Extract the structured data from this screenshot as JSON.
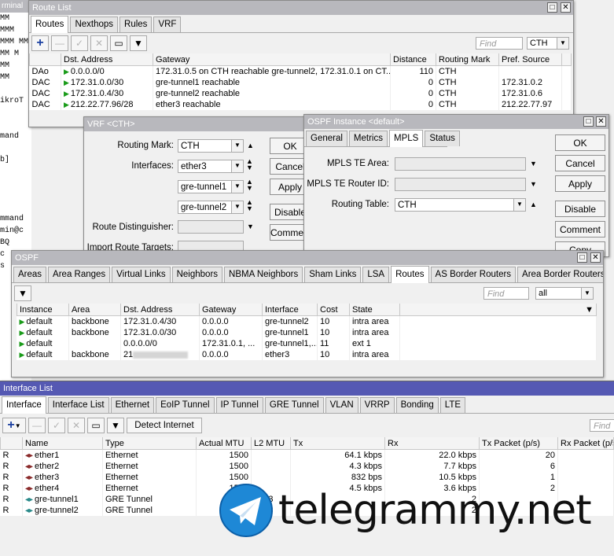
{
  "terminal": {
    "title": "rminal",
    "lines": [
      "MM",
      "MMM",
      "MMM MM",
      "MM  M",
      "MM",
      "MM",
      "",
      "ikroT",
      "",
      "",
      "mand",
      "",
      "b]",
      "",
      "",
      "",
      "",
      "mmand",
      "min@c",
      "BQ",
      "c",
      "s"
    ]
  },
  "route_list": {
    "title": "Route List",
    "tabs": [
      "Routes",
      "Nexthops",
      "Rules",
      "VRF"
    ],
    "find_placeholder": "Find",
    "filter_value": "CTH",
    "columns": [
      "",
      "Dst. Address",
      "Gateway",
      "Distance",
      "Routing Mark",
      "Pref. Source"
    ],
    "rows": [
      {
        "flags": "DAo",
        "dst": "0.0.0.0/0",
        "gateway": "172.31.0.5 on CTH reachable gre-tunnel2, 172.31.0.1 on CT...",
        "distance": "110",
        "mark": "CTH",
        "pref": ""
      },
      {
        "flags": "DAC",
        "dst": "172.31.0.0/30",
        "gateway": "gre-tunnel1 reachable",
        "distance": "0",
        "mark": "CTH",
        "pref": "172.31.0.2"
      },
      {
        "flags": "DAC",
        "dst": "172.31.0.4/30",
        "gateway": "gre-tunnel2 reachable",
        "distance": "0",
        "mark": "CTH",
        "pref": "172.31.0.6"
      },
      {
        "flags": "DAC",
        "dst": "212.22.77.96/28",
        "gateway": "ether3 reachable",
        "distance": "0",
        "mark": "CTH",
        "pref": "212.22.77.97"
      }
    ]
  },
  "vrf": {
    "title": "VRF <CTH>",
    "routing_mark_label": "Routing Mark:",
    "routing_mark": "CTH",
    "interfaces_label": "Interfaces:",
    "interfaces": [
      "ether3",
      "gre-tunnel1",
      "gre-tunnel2"
    ],
    "rd_label": "Route Distinguisher:",
    "irt_label": "Import Route Targets:",
    "buttons": [
      "OK",
      "Cancel",
      "Apply",
      "Disable",
      "Comment"
    ]
  },
  "ospf_instance": {
    "title": "OSPF Instance <default>",
    "tabs": [
      "General",
      "Metrics",
      "MPLS",
      "Status"
    ],
    "mpls_te_area_label": "MPLS TE Area:",
    "mpls_te_router_id_label": "MPLS TE Router ID:",
    "routing_table_label": "Routing Table:",
    "routing_table": "CTH",
    "buttons": [
      "OK",
      "Cancel",
      "Apply",
      "Disable",
      "Comment",
      "Copy"
    ]
  },
  "ospf": {
    "title": "OSPF",
    "tabs": [
      "Areas",
      "Area Ranges",
      "Virtual Links",
      "Neighbors",
      "NBMA Neighbors",
      "Sham Links",
      "LSA",
      "Routes",
      "AS Border Routers",
      "Area Border Routers",
      "..."
    ],
    "find_placeholder": "Find",
    "filter_value": "all",
    "columns": [
      "Instance",
      "Area",
      "Dst. Address",
      "Gateway",
      "Interface",
      "Cost",
      "State"
    ],
    "rows": [
      {
        "instance": "default",
        "area": "backbone",
        "dst": "172.31.0.4/30",
        "gateway": "0.0.0.0",
        "iface": "gre-tunnel2",
        "cost": "10",
        "state": "intra area"
      },
      {
        "instance": "default",
        "area": "backbone",
        "dst": "172.31.0.0/30",
        "gateway": "0.0.0.0",
        "iface": "gre-tunnel1",
        "cost": "10",
        "state": "intra area"
      },
      {
        "instance": "default",
        "area": "",
        "dst": "0.0.0.0/0",
        "gateway": "172.31.0.1, ...",
        "iface": "gre-tunnel1,...",
        "cost": "11",
        "state": "ext 1"
      },
      {
        "instance": "default",
        "area": "backbone",
        "dst": "21",
        "gateway": "0.0.0.0",
        "iface": "ether3",
        "cost": "10",
        "state": "intra area"
      }
    ]
  },
  "interface_list": {
    "title": "Interface List",
    "tabs": [
      "Interface",
      "Interface List",
      "Ethernet",
      "EoIP Tunnel",
      "IP Tunnel",
      "GRE Tunnel",
      "VLAN",
      "VRRP",
      "Bonding",
      "LTE"
    ],
    "detect_label": "Detect Internet",
    "find_placeholder": "Find",
    "columns": [
      "",
      "Name",
      "Type",
      "Actual MTU",
      "L2 MTU",
      "Tx",
      "Rx",
      "Tx Packet (p/s)",
      "Rx Packet (p/s)"
    ],
    "rows": [
      {
        "flag": "R",
        "name": "ether1",
        "type": "Ethernet",
        "mtu": "1500",
        "l2": "",
        "tx": "64.1 kbps",
        "rx": "22.0 kbps",
        "txp": "20"
      },
      {
        "flag": "R",
        "name": "ether2",
        "type": "Ethernet",
        "mtu": "1500",
        "l2": "",
        "tx": "4.3 kbps",
        "rx": "7.7 kbps",
        "txp": "6"
      },
      {
        "flag": "R",
        "name": "ether3",
        "type": "Ethernet",
        "mtu": "1500",
        "l2": "",
        "tx": "832 bps",
        "rx": "10.5 kbps",
        "txp": "1"
      },
      {
        "flag": "R",
        "name": "ether4",
        "type": "Ethernet",
        "mtu": "1500",
        "l2": "",
        "tx": "4.5 kbps",
        "rx": "3.6 kbps",
        "txp": "2"
      },
      {
        "flag": "R",
        "name": "gre-tunnel1",
        "type": "GRE Tunnel",
        "mtu": "",
        "l2": "6553",
        "tx": "",
        "rx": "2",
        "txp": ""
      },
      {
        "flag": "R",
        "name": "gre-tunnel2",
        "type": "GRE Tunnel",
        "mtu": "",
        "l2": "6553",
        "tx": "",
        "rx": "2",
        "txp": ""
      }
    ]
  },
  "watermark": "telegrammy.net",
  "colors": {
    "active_title": "#5559b3",
    "inactive_title": "#b8b8bd",
    "flag_green": "#1a9b1a"
  }
}
